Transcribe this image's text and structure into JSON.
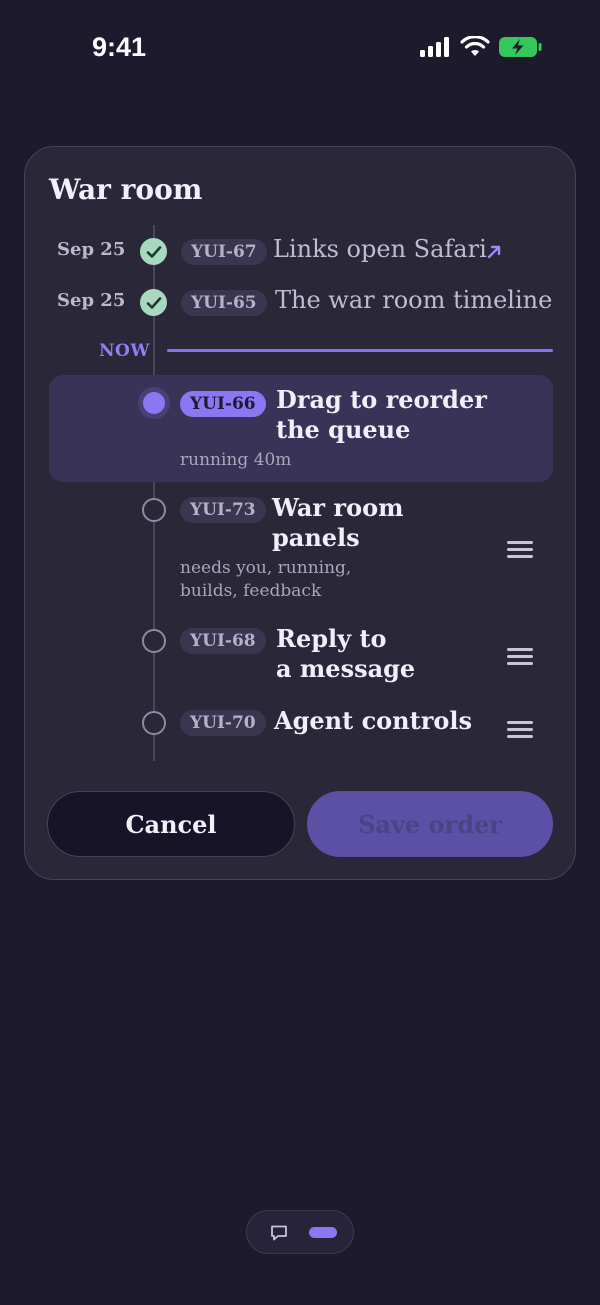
{
  "status_bar": {
    "time": "9:41"
  },
  "card": {
    "title": "War room",
    "now_label": "NOW",
    "done_items": [
      {
        "date": "Sep 25",
        "tag": "YUI-67",
        "text": "Links open Safari",
        "has_link_arrow": true
      },
      {
        "date": "Sep 25",
        "tag": "YUI-65",
        "text": "The war room timeline"
      }
    ],
    "active_item": {
      "tag": "YUI-66",
      "title_line1": "Drag to reorder",
      "title_line2": "the queue",
      "subtitle": "running 40m"
    },
    "queue_items": [
      {
        "tag": "YUI-73",
        "title_line1": "War room",
        "title_line2": "panels",
        "sub_line1": "needs you, running,",
        "sub_line2": "builds, feedback"
      },
      {
        "tag": "YUI-68",
        "title_line1": "Reply to",
        "title_line2": "a message"
      },
      {
        "tag": "YUI-70",
        "title_line1": "Agent controls"
      }
    ],
    "buttons": {
      "cancel": "Cancel",
      "save": "Save order"
    }
  },
  "colors": {
    "background": "#1c1a2c",
    "card": "#2a2739",
    "accent": "#8a78f2",
    "done_check": "#a8d8c0",
    "battery": "#34c759"
  },
  "icons": {
    "done": "check-circle-icon",
    "link": "arrow-up-right-icon",
    "reorder": "drag-handle-icon",
    "bottom_nav": "chat-bubble-icon"
  }
}
